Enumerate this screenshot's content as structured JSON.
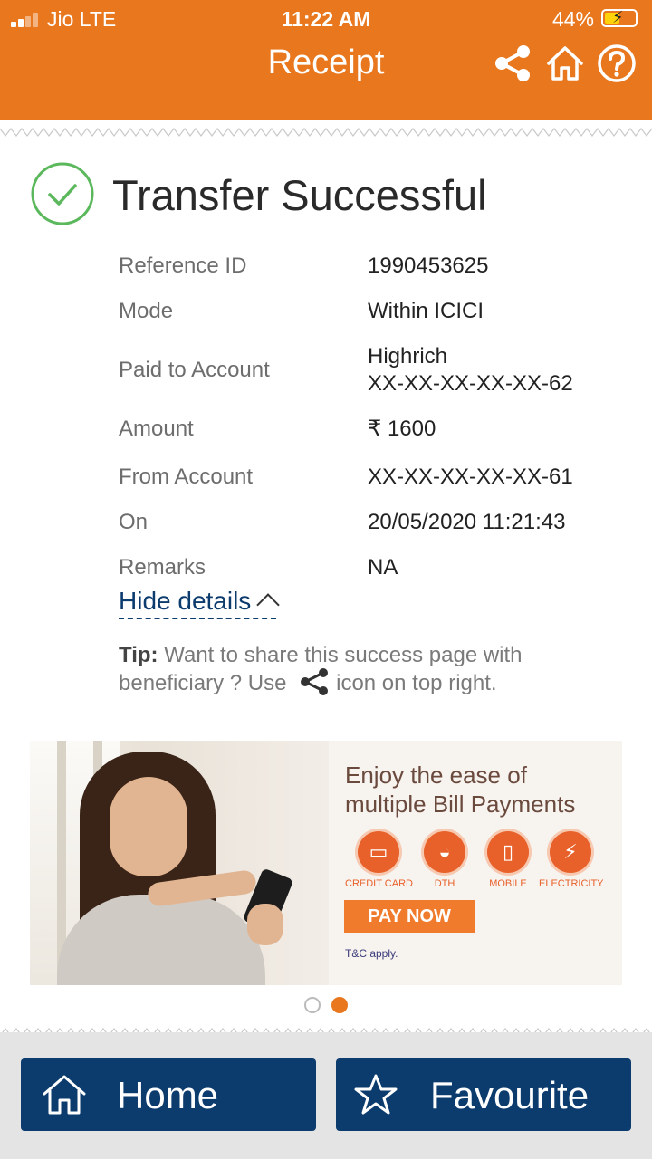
{
  "status_bar": {
    "carrier": "Jio  LTE",
    "time": "11:22 AM",
    "battery": "44%"
  },
  "header": {
    "title": "Receipt",
    "icons": [
      "share-icon",
      "home-icon",
      "help-icon"
    ]
  },
  "result": {
    "title": "Transfer Successful",
    "icon": "check-circle-icon"
  },
  "details": [
    {
      "label": "Reference ID",
      "value": "1990453625"
    },
    {
      "label": "Mode",
      "value": "Within ICICI"
    },
    {
      "label": "Paid to Account",
      "value": "Highrich",
      "value2": "XX-XX-XX-XX-XX-62"
    },
    {
      "label": "Amount",
      "value": "₹ 1600"
    },
    {
      "label": "From Account",
      "value": "XX-XX-XX-XX-XX-61"
    },
    {
      "label": "On",
      "value": "20/05/2020 11:21:43"
    },
    {
      "label": "Remarks",
      "value": "NA"
    }
  ],
  "hide_details": "Hide details",
  "tip": {
    "bold": "Tip:",
    "text_before": " Want to share this success page with beneficiary ? Use",
    "text_after": "icon on top right."
  },
  "banner": {
    "title_line1": "Enjoy the ease of",
    "title_line2": "multiple Bill Payments",
    "items": [
      "CREDIT CARD",
      "DTH",
      "MOBILE",
      "ELECTRICITY"
    ],
    "cta": "PAY NOW",
    "note": "T&C apply."
  },
  "carousel": {
    "count": 2,
    "active": 2
  },
  "bottom_bar": {
    "home": "Home",
    "favourite": "Favourite"
  },
  "colors": {
    "brand_orange": "#E8771E",
    "navy": "#0C3B6E",
    "success_green": "#5CB85C"
  }
}
